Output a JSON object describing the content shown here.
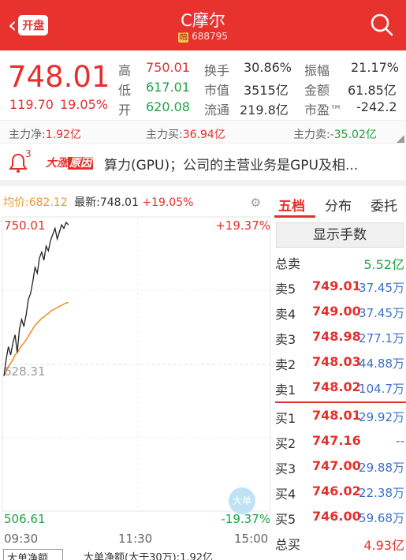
{
  "header": {
    "back_label": "开盘",
    "title": "C摩尔",
    "rong": "融",
    "code": "688795"
  },
  "quote": {
    "price": "748.01",
    "change": "119.70",
    "change_pct": "19.05%",
    "high_label": "高",
    "high": "750.01",
    "low_label": "低",
    "low": "617.01",
    "open_label": "开",
    "open": "620.08",
    "turnover_label": "换手",
    "turnover": "30.86%",
    "mktcap_label": "市值",
    "mktcap": "3515亿",
    "float_label": "流通",
    "float": "219.8亿",
    "amplitude_label": "振幅",
    "amplitude": "21.17%",
    "amount_label": "金额",
    "amount": "61.85亿",
    "pe_label": "市盈™",
    "pe": "-242.2"
  },
  "flow": {
    "net_label": "主力净:",
    "net": "1.92亿",
    "buy_label": "主力买:",
    "buy": "36.94亿",
    "sell_label": "主力卖:",
    "sell": "-35.02亿"
  },
  "news": {
    "badge": "3",
    "tag_a": "大涨",
    "tag_b": "原因",
    "text": "算力(GPU)；公司的主营业务是GPU及相..."
  },
  "chart": {
    "avg_label": "均价:682.12",
    "latest_label": "最新:748.01",
    "latest_pct": "+19.05%",
    "high_price": "750.01",
    "high_pct": "+19.37%",
    "mid_price": "628.31",
    "low_price": "506.61",
    "low_pct": "-19.37%",
    "t_start": "09:30",
    "t_mid": "11:30",
    "t_end": "15:00",
    "dadan": "大单",
    "bottom_select": "大单净额",
    "bottom_text": "大单净额(大于30万):1.92亿"
  },
  "chart_data": {
    "type": "line",
    "ylim": [
      506.61,
      750.01
    ],
    "x": [
      0,
      2,
      4,
      6,
      8,
      10,
      12,
      14,
      16,
      18,
      20,
      22,
      24,
      26,
      28,
      30,
      32,
      34,
      36,
      38,
      40,
      42,
      44,
      46,
      48,
      50,
      52,
      54,
      56,
      58
    ],
    "series": [
      {
        "values": [
          620.08,
          634,
          645,
          638,
          648,
          655,
          640,
          660,
          668,
          662,
          672,
          685,
          690,
          700,
          712,
          707,
          720,
          725,
          718,
          730,
          726,
          735,
          740,
          745,
          736,
          742,
          748,
          745,
          750,
          748.01
        ]
      },
      {
        "values": [
          620.08,
          624,
          628,
          631,
          634,
          638,
          640,
          643,
          646,
          648,
          651,
          654,
          657,
          660,
          663,
          665,
          667,
          669,
          670,
          672,
          673,
          675,
          676,
          677,
          678,
          679,
          680,
          681,
          682,
          682.12
        ]
      }
    ]
  },
  "orderbook": {
    "tabs": [
      "五档",
      "分布",
      "委托"
    ],
    "show_btn": "显示手数",
    "total_sell_label": "总卖",
    "total_sell": "5.52亿",
    "asks": [
      {
        "k": "卖5",
        "p": "749.01",
        "v": "37.45万"
      },
      {
        "k": "卖4",
        "p": "749.00",
        "v": "37.45万"
      },
      {
        "k": "卖3",
        "p": "748.98",
        "v": "277.1万"
      },
      {
        "k": "卖2",
        "p": "748.03",
        "v": "44.88万"
      },
      {
        "k": "卖1",
        "p": "748.02",
        "v": "104.7万"
      }
    ],
    "bids": [
      {
        "k": "买1",
        "p": "748.01",
        "v": "29.92万"
      },
      {
        "k": "买2",
        "p": "747.16",
        "v": "--"
      },
      {
        "k": "买3",
        "p": "747.00",
        "v": "29.88万"
      },
      {
        "k": "买4",
        "p": "746.02",
        "v": "22.38万"
      },
      {
        "k": "买5",
        "p": "746.00",
        "v": "59.68万"
      }
    ],
    "total_buy_label": "总买",
    "total_buy": "4.93亿"
  }
}
